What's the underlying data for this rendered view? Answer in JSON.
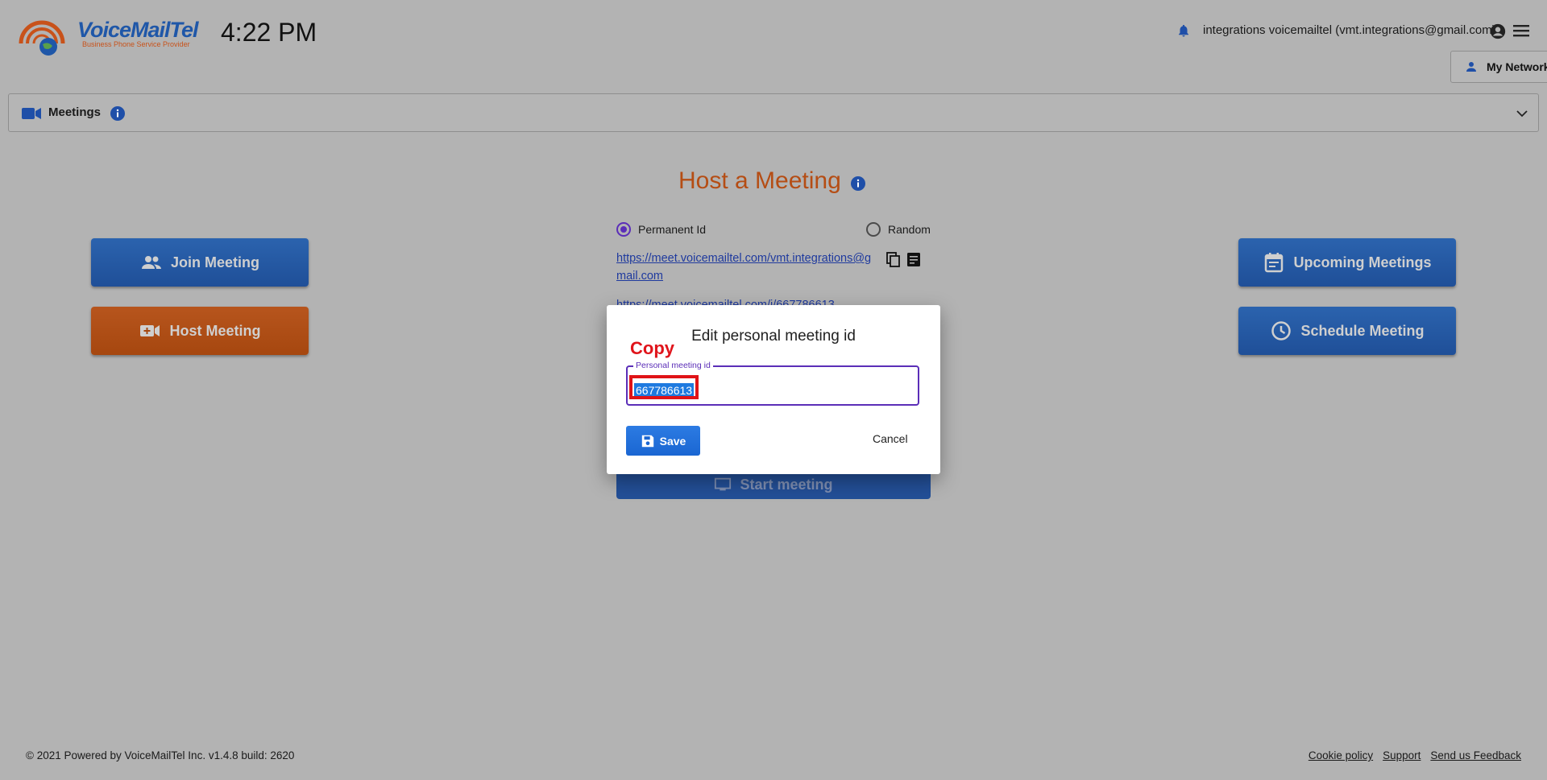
{
  "header": {
    "logo_text": "VoiceMailTel",
    "logo_tagline": "Business Phone Service Provider",
    "clock": "4:22 PM",
    "user_label": "integrations voicemailtel (vmt.integrations@gmail.com)",
    "network_button": "My Network"
  },
  "meetings_bar": {
    "title": "Meetings"
  },
  "main": {
    "heading": "Host a Meeting",
    "left_buttons": {
      "join": "Join Meeting",
      "host": "Host Meeting"
    },
    "right_buttons": {
      "upcoming": "Upcoming Meetings",
      "schedule": "Schedule Meeting"
    },
    "radio_permanent": "Permanent Id",
    "radio_random": "Random",
    "selected_option": "Permanent Id",
    "permanent_url": "https://meet.voicemailtel.com/vmt.integrations@gmail.com",
    "id_url": "https://meet.voicemailtel.com/i/667786613",
    "start_button": "Start meeting"
  },
  "dialog": {
    "title": "Edit personal meeting id",
    "annotation": "Copy",
    "field_label": "Personal meeting id",
    "field_value": "667786613",
    "save": "Save",
    "cancel": "Cancel"
  },
  "footer": {
    "copyright": "© 2021 Powered by VoiceMailTel Inc. v1.4.8 build: 2620",
    "links": [
      "Cookie policy",
      "Support",
      "Send us Feedback"
    ]
  },
  "colors": {
    "brand_blue": "#1f4f98",
    "brand_orange": "#b54d14",
    "dialog_accent": "#5b2eb8",
    "annotation_red": "#e0141b"
  }
}
